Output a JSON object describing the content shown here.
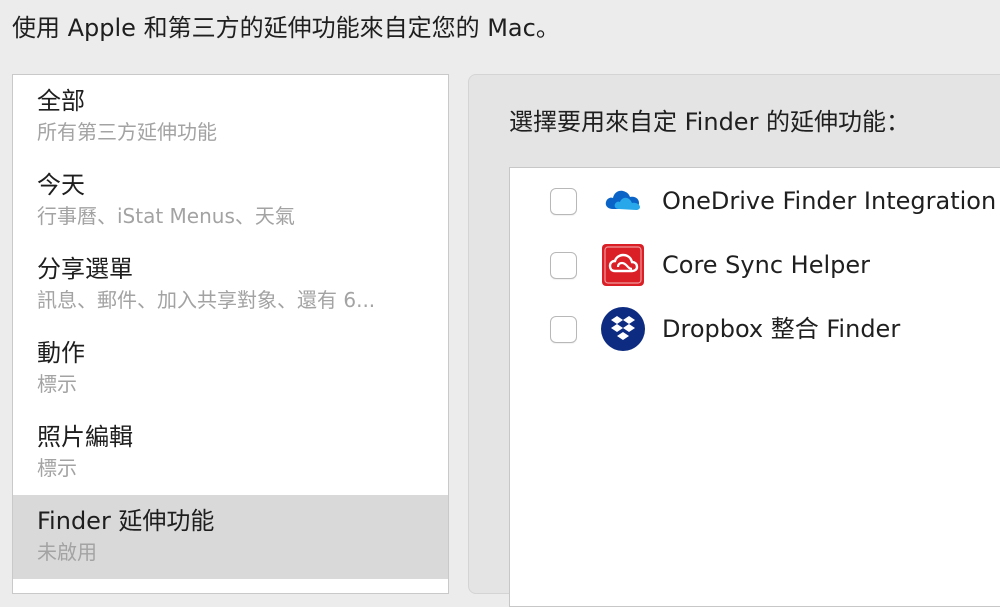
{
  "header": {
    "text": "使用 Apple 和第三方的延伸功能來自定您的 Mac。"
  },
  "sidebar": {
    "items": [
      {
        "title": "全部",
        "subtitle": "所有第三方延伸功能",
        "selected": false
      },
      {
        "title": "今天",
        "subtitle": "行事曆、iStat Menus、天氣",
        "selected": false
      },
      {
        "title": "分享選單",
        "subtitle": "訊息、郵件、加入共享對象、還有 6...",
        "selected": false
      },
      {
        "title": "動作",
        "subtitle": "標示",
        "selected": false
      },
      {
        "title": "照片編輯",
        "subtitle": "標示",
        "selected": false
      },
      {
        "title": "Finder 延伸功能",
        "subtitle": "未啟用",
        "selected": true
      }
    ]
  },
  "panel": {
    "title": "選擇要用來自定 Finder 的延伸功能：",
    "extensions": [
      {
        "label": "OneDrive Finder Integration",
        "checked": false,
        "icon": "onedrive-cloud-icon"
      },
      {
        "label": "Core Sync Helper",
        "checked": false,
        "icon": "adobe-creative-cloud-icon"
      },
      {
        "label": "Dropbox 整合 Finder",
        "checked": false,
        "icon": "dropbox-icon"
      }
    ]
  },
  "colors": {
    "window_bg": "#ececec",
    "selected_row": "#d9d9d9",
    "secondary_text": "#a3a3a3",
    "onedrive_blue": "#0a64c8",
    "adobe_red": "#da1f26",
    "dropbox_navy": "#0d2b80"
  }
}
